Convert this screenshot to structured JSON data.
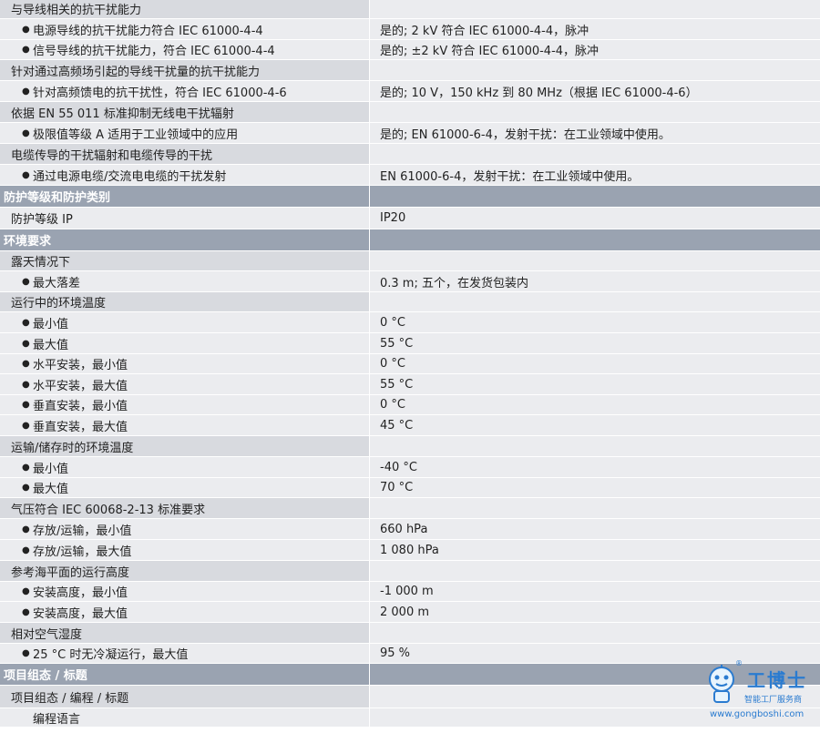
{
  "rows": [
    {
      "type": "subheader",
      "label": "与导线相关的抗干扰能力",
      "value": ""
    },
    {
      "type": "item",
      "label": "电源导线的抗干扰能力符合 IEC 61000-4-4",
      "value": "是的; 2 kV 符合 IEC 61000-4-4，脉冲"
    },
    {
      "type": "item",
      "label": "信号导线的抗干扰能力，符合 IEC 61000-4-4",
      "value": "是的; ±2 kV 符合 IEC 61000-4-4，脉冲"
    },
    {
      "type": "subheader",
      "label": "针对通过高频场引起的导线干扰量的抗干扰能力",
      "value": ""
    },
    {
      "type": "item",
      "label": "针对高频馈电的抗干扰性，符合 IEC 61000-4-6",
      "value": "是的; 10 V，150 kHz 到 80 MHz（根据 IEC 61000-4-6）"
    },
    {
      "type": "subheader",
      "label": "依据 EN 55 011 标准抑制无线电干扰辐射",
      "value": ""
    },
    {
      "type": "item",
      "label": "极限值等级 A 适用于工业领域中的应用",
      "value": "是的; EN 61000-6-4，发射干扰：在工业领域中使用。"
    },
    {
      "type": "subheader",
      "label": "电缆传导的干扰辐射和电缆传导的干扰",
      "value": ""
    },
    {
      "type": "item",
      "label": "通过电源电缆/交流电电缆的干扰发射",
      "value": "EN 61000-6-4，发射干扰：在工业领域中使用。"
    },
    {
      "type": "section",
      "label": "防护等级和防护类别",
      "value": ""
    },
    {
      "type": "single",
      "label": "防护等级 IP",
      "value": "IP20"
    },
    {
      "type": "section",
      "label": "环境要求",
      "value": ""
    },
    {
      "type": "subheader",
      "label": "露天情况下",
      "value": ""
    },
    {
      "type": "item",
      "label": "最大落差",
      "value": "0.3 m; 五个，在发货包装内"
    },
    {
      "type": "subheader",
      "label": "运行中的环境温度",
      "value": ""
    },
    {
      "type": "item",
      "label": "最小值",
      "value": "0 °C"
    },
    {
      "type": "item",
      "label": "最大值",
      "value": "55 °C"
    },
    {
      "type": "item",
      "label": "水平安装，最小值",
      "value": "0 °C"
    },
    {
      "type": "item",
      "label": "水平安装，最大值",
      "value": "55 °C"
    },
    {
      "type": "item",
      "label": "垂直安装，最小值",
      "value": "0 °C"
    },
    {
      "type": "item",
      "label": "垂直安装，最大值",
      "value": "45 °C"
    },
    {
      "type": "subheader",
      "label": "运输/储存时的环境温度",
      "value": ""
    },
    {
      "type": "item",
      "label": "最小值",
      "value": "-40 °C"
    },
    {
      "type": "item",
      "label": "最大值",
      "value": "70 °C"
    },
    {
      "type": "subheader",
      "label": "气压符合 IEC 60068-2-13 标准要求",
      "value": ""
    },
    {
      "type": "item",
      "label": "存放/运输，最小值",
      "value": "660 hPa"
    },
    {
      "type": "item",
      "label": "存放/运输，最大值",
      "value": "1 080 hPa"
    },
    {
      "type": "subheader",
      "label": "参考海平面的运行高度",
      "value": ""
    },
    {
      "type": "item",
      "label": "安装高度，最小值",
      "value": "-1 000 m"
    },
    {
      "type": "item",
      "label": "安装高度，最大值",
      "value": "2 000 m"
    },
    {
      "type": "subheader",
      "label": "相对空气湿度",
      "value": ""
    },
    {
      "type": "item",
      "label": "25 °C 时无冷凝运行，最大值",
      "value": "95 %"
    },
    {
      "type": "section",
      "label": "项目组态 / 标题",
      "value": ""
    },
    {
      "type": "subheader",
      "label": "项目组态 / 编程 / 标题",
      "value": ""
    },
    {
      "type": "sub2",
      "label": "编程语言",
      "value": ""
    }
  ],
  "bullet_glyph": "●",
  "watermark": {
    "name": "工博士",
    "subtitle": "智能工厂服务商",
    "url": "www.gongboshi.com",
    "registered": "®"
  }
}
